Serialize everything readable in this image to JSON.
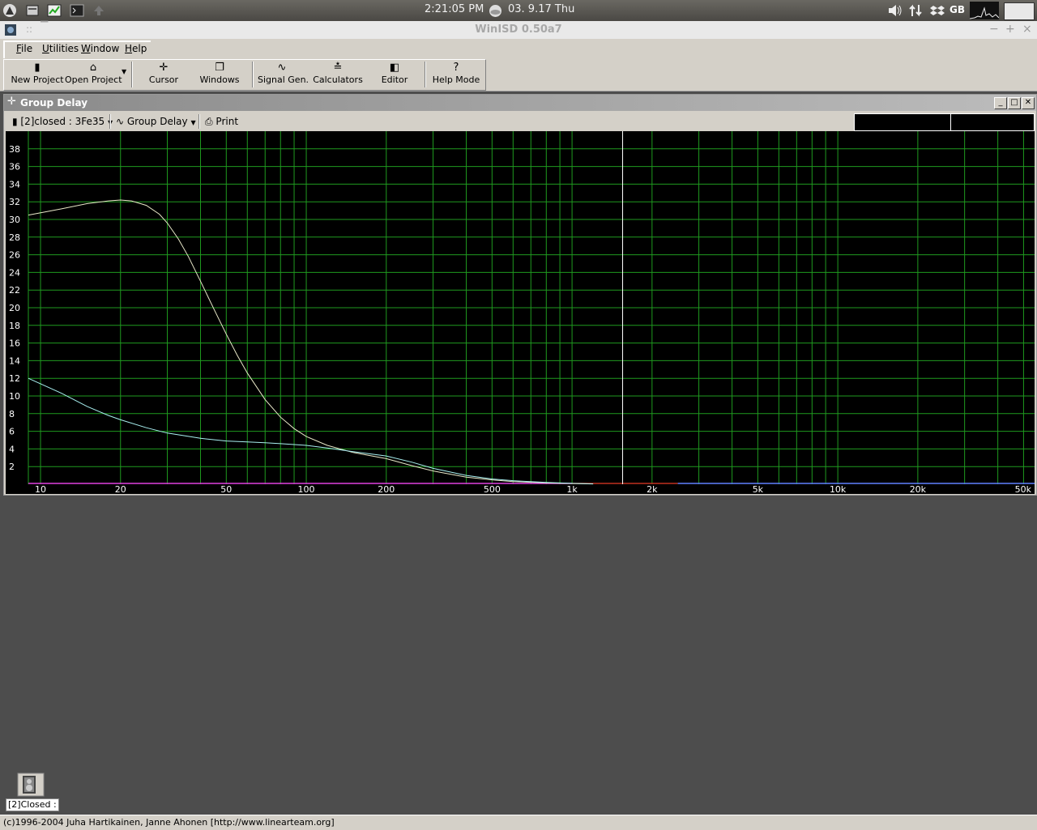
{
  "panel": {
    "clock": "2:21:05 PM",
    "date": "03. 9.17 Thu",
    "keyboard_layout": "GB"
  },
  "window": {
    "title": "WinISD 0.50a7",
    "controls": [
      "−",
      "+",
      "×"
    ]
  },
  "menu": {
    "items": [
      {
        "label": "File",
        "underline": "F",
        "rest": "ile"
      },
      {
        "label": "Utilities",
        "underline": "U",
        "rest": "tilities"
      },
      {
        "label": "Window",
        "underline": "W",
        "rest": "indow"
      },
      {
        "label": "Help",
        "underline": "H",
        "rest": "elp"
      }
    ]
  },
  "toolbar": {
    "new_project": "New Project",
    "open_project": "Open Project",
    "cursor": "Cursor",
    "windows": "Windows",
    "signal_gen": "Signal Gen.",
    "calculators": "Calculators",
    "editor": "Editor",
    "help_mode": "Help Mode"
  },
  "child_window": {
    "title": "Group Delay",
    "project_combo": "[2]closed : 3Fe35",
    "graph_combo": "Group Delay",
    "print": "Print"
  },
  "chart_data": {
    "type": "line",
    "title": "",
    "xlabel": "",
    "ylabel": "",
    "x_scale": "log",
    "xlim": [
      9,
      55000
    ],
    "ylim": [
      0,
      40
    ],
    "grid": true,
    "legend": "none",
    "x_ticks": [
      {
        "value": 10,
        "label": "10"
      },
      {
        "value": 20,
        "label": "20"
      },
      {
        "value": 50,
        "label": "50"
      },
      {
        "value": 100,
        "label": "100"
      },
      {
        "value": 200,
        "label": "200"
      },
      {
        "value": 500,
        "label": "500"
      },
      {
        "value": 1000,
        "label": "1k"
      },
      {
        "value": 2000,
        "label": "2k"
      },
      {
        "value": 5000,
        "label": "5k"
      },
      {
        "value": 10000,
        "label": "10k"
      },
      {
        "value": 20000,
        "label": "20k"
      },
      {
        "value": 50000,
        "label": "50k"
      }
    ],
    "y_ticks": [
      2,
      4,
      6,
      8,
      10,
      12,
      14,
      16,
      18,
      20,
      22,
      24,
      26,
      28,
      30,
      32,
      34,
      36,
      38
    ],
    "cursor_x": 1550,
    "series": [
      {
        "color": "#e8e8c8",
        "x": [
          9,
          12,
          15,
          18,
          20,
          22,
          25,
          28,
          30,
          33,
          36,
          40,
          45,
          50,
          55,
          60,
          70,
          80,
          90,
          100,
          120,
          150,
          200,
          250,
          300,
          400,
          500,
          600,
          800,
          1000,
          1200
        ],
        "y": [
          30.5,
          31.2,
          31.8,
          32.1,
          32.2,
          32.1,
          31.6,
          30.6,
          29.6,
          27.8,
          25.8,
          23.0,
          19.8,
          17.0,
          14.6,
          12.6,
          9.6,
          7.6,
          6.3,
          5.4,
          4.4,
          3.6,
          2.9,
          2.1,
          1.5,
          0.8,
          0.5,
          0.3,
          0.15,
          0.08,
          0.04
        ]
      },
      {
        "color": "#a8f0f0",
        "x": [
          9,
          12,
          15,
          18,
          20,
          25,
          30,
          40,
          50,
          60,
          70,
          80,
          100,
          120,
          150,
          200,
          250,
          300,
          400,
          500,
          600,
          800,
          1000,
          1200
        ],
        "y": [
          12.0,
          10.3,
          8.8,
          7.8,
          7.3,
          6.4,
          5.8,
          5.2,
          4.9,
          4.8,
          4.7,
          4.6,
          4.4,
          4.1,
          3.7,
          3.2,
          2.5,
          1.8,
          1.0,
          0.6,
          0.4,
          0.2,
          0.1,
          0.05
        ]
      }
    ],
    "baseline_segments": [
      {
        "color": "#e040e0",
        "x": [
          9,
          1000
        ]
      },
      {
        "color": "#c03020",
        "x": [
          1000,
          2500
        ]
      },
      {
        "color": "#6080ff",
        "x": [
          2500,
          55000
        ]
      }
    ]
  },
  "minimized": {
    "label": "[2]Closed :"
  },
  "status": {
    "text": "(c)1996-2004 Juha Hartikainen, Janne Ahonen [http://www.linearteam.org]"
  }
}
